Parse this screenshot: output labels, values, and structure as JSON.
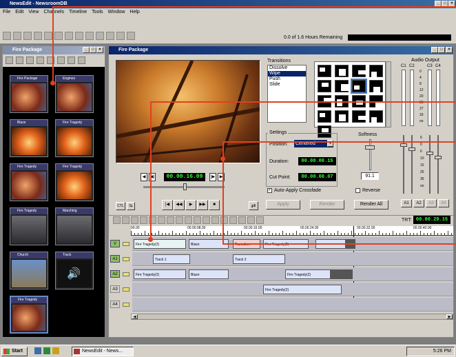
{
  "app": {
    "title": "NewsEdit - NewsroomDB",
    "menu": [
      "File",
      "Edit",
      "View",
      "Channels",
      "Timeline",
      "Tools",
      "Window",
      "Help"
    ],
    "hours_remaining": "0.0 of 1.6 Hours Remaining"
  },
  "bin": {
    "title": "Fire Package",
    "items": [
      {
        "label": "Fire Package",
        "kind": "fire"
      },
      {
        "label": "Engines",
        "kind": "fire"
      },
      {
        "label": "Blaze",
        "kind": "flame"
      },
      {
        "label": "Fire Tragedy",
        "kind": "flame"
      },
      {
        "label": "Fire Tragedy",
        "kind": "fire"
      },
      {
        "label": "Fire Tragedy",
        "kind": "flame"
      },
      {
        "label": "Fire Tragedy",
        "kind": "crowd"
      },
      {
        "label": "Marching",
        "kind": "crowd"
      },
      {
        "label": "Church",
        "kind": "church"
      },
      {
        "label": "Track",
        "kind": "audio"
      },
      {
        "label": "Fire Tragedy",
        "kind": "fire"
      }
    ]
  },
  "editor": {
    "title": "Fire Package",
    "timecode": "00.00.16.09",
    "ctl_label": "CTL"
  },
  "transitions": {
    "label": "Transitions",
    "options": [
      "Dissolve",
      "Wipe",
      "Push",
      "Slide"
    ],
    "selected": "Wipe"
  },
  "settings": {
    "label": "Settings",
    "position_label": "Position:",
    "position_value": "Centered",
    "duration_label": "Duration:",
    "duration_value": "00.00.00.15",
    "cutpoint_label": "Cut Point:",
    "cutpoint_value": "00.00.00.07",
    "auto_crossfade": "Auto-Apply Crossfade",
    "apply": "Apply",
    "render": "Render",
    "render_all": "Render All",
    "softness_label": "Softness",
    "softness_value": "91.1",
    "reverse": "Reverse"
  },
  "audio": {
    "label": "Audio Output",
    "channels": [
      "C1",
      "C2",
      "C3",
      "C4"
    ],
    "scale": [
      "0",
      "4",
      "8",
      "12",
      "20",
      "25",
      "27",
      "33",
      "oo"
    ],
    "scale2": [
      "6",
      "0",
      "6",
      "10",
      "15",
      "25",
      "35",
      "oo"
    ],
    "buttons": [
      "A1",
      "A2",
      "A3",
      "A4"
    ]
  },
  "timeline": {
    "trt_label": "TRT:",
    "trt_value": "00.00.29.15",
    "ruler": [
      "00.00",
      "00.00.08.00",
      "00.00.16.00",
      "00.00.24.00",
      "00.00.32.00",
      "00.00.40.00"
    ],
    "tracks": [
      {
        "label": "V",
        "clips": [
          {
            "text": "Fire Tragedy(2)"
          },
          {
            "text": "Blaze"
          },
          {
            "text": "Transition"
          },
          {
            "text": "Fire Tragedy(2)"
          }
        ]
      },
      {
        "label": "A1",
        "clips": [
          {
            "text": "Track 1"
          },
          {
            "text": "Track 2"
          }
        ]
      },
      {
        "label": "A2",
        "clips": [
          {
            "text": "Fire Tragedy(2)"
          },
          {
            "text": "Blaze"
          },
          {
            "text": "Fire Tragedy(2)"
          }
        ]
      },
      {
        "label": "A3",
        "clips": [
          {
            "text": "Fire Tragedy(2)"
          }
        ]
      },
      {
        "label": "A4",
        "clips": []
      }
    ]
  },
  "taskbar": {
    "start": "Start",
    "task": "NewsEdit - News...",
    "clock": "5:26 PM"
  },
  "colors": {
    "accent": "#e04020",
    "title_bar": "#0a246a",
    "timecode": "#33ff33"
  }
}
